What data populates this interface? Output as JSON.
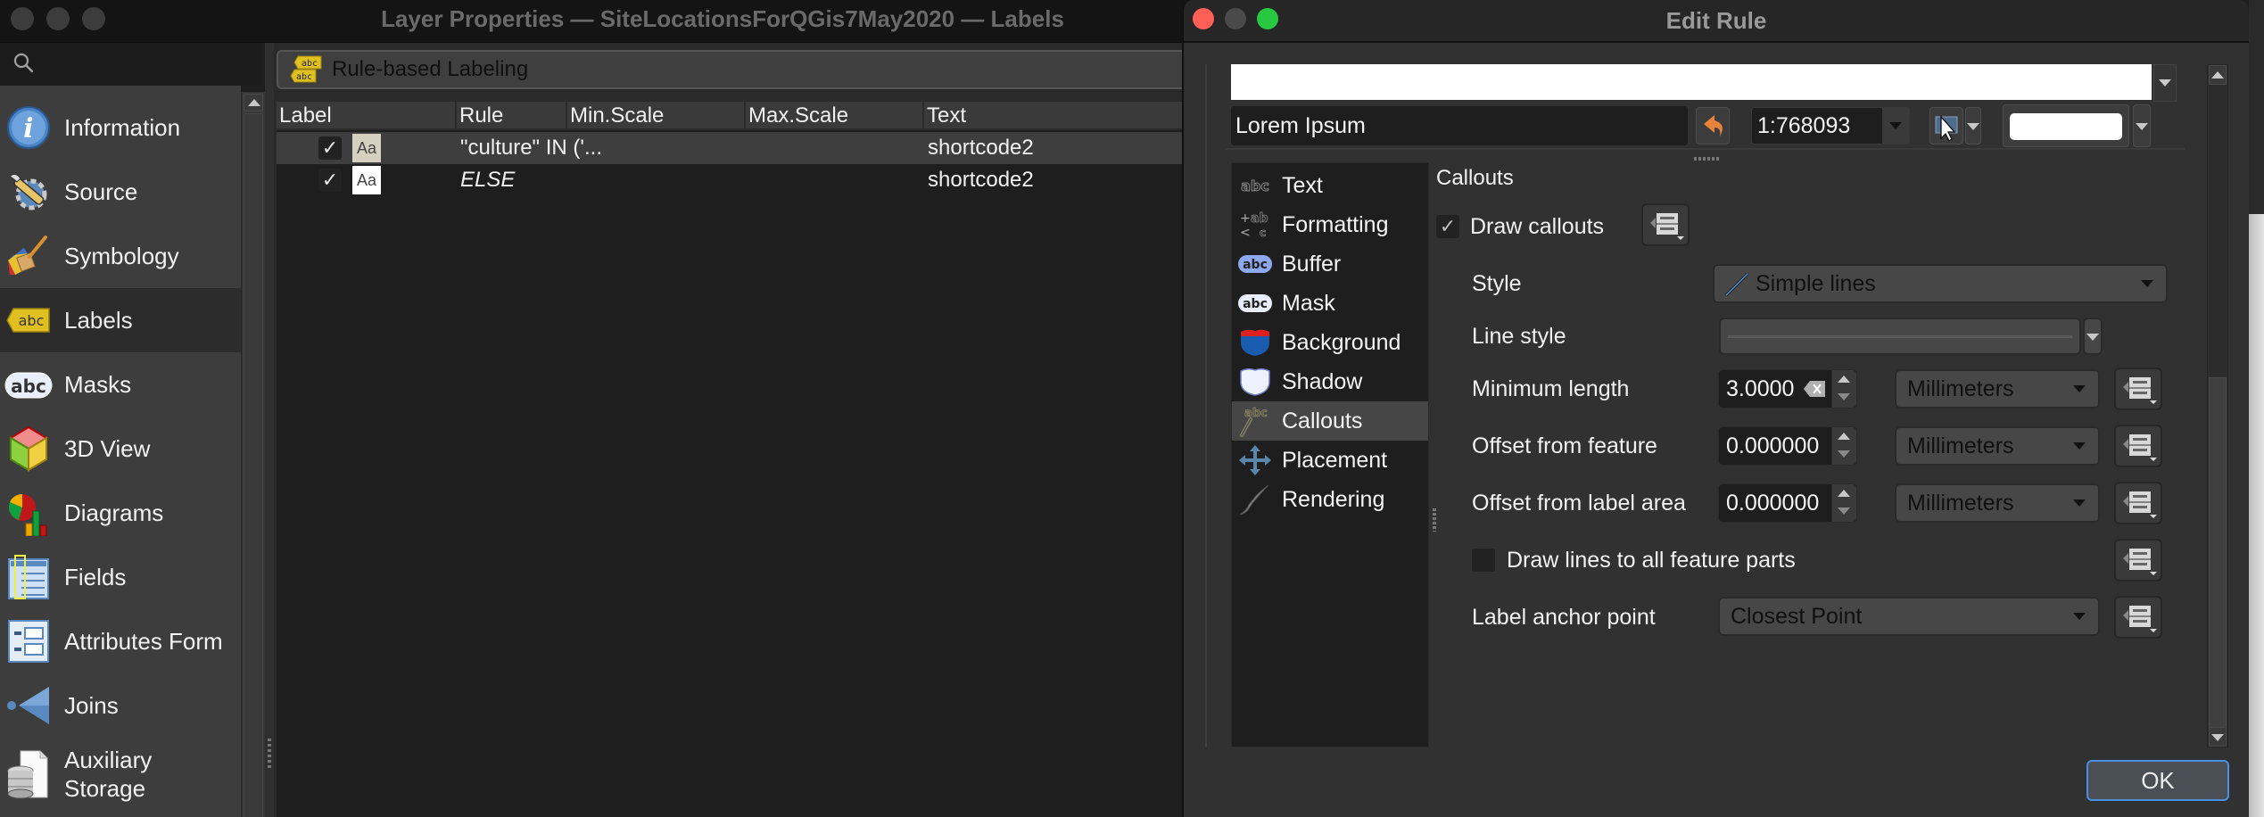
{
  "main_window": {
    "title": "Layer Properties — SiteLocationsForQGis7May2020 — Labels",
    "search": {
      "placeholder": "",
      "value": ""
    },
    "sidebar": {
      "selected": "Labels",
      "items": [
        {
          "label": "Information",
          "icon": "information-icon"
        },
        {
          "label": "Source",
          "icon": "source-icon"
        },
        {
          "label": "Symbology",
          "icon": "symbology-icon"
        },
        {
          "label": "Labels",
          "icon": "labels-icon"
        },
        {
          "label": "Masks",
          "icon": "masks-icon"
        },
        {
          "label": "3D View",
          "icon": "3d-view-icon"
        },
        {
          "label": "Diagrams",
          "icon": "diagrams-icon"
        },
        {
          "label": "Fields",
          "icon": "fields-icon"
        },
        {
          "label": "Attributes Form",
          "icon": "attributes-form-icon"
        },
        {
          "label": "Joins",
          "icon": "joins-icon"
        },
        {
          "label": "Auxiliary Storage",
          "icon": "auxiliary-storage-icon"
        }
      ]
    },
    "labeling_mode": "Rule-based Labeling",
    "rules_table": {
      "columns": [
        "Label",
        "Rule",
        "Min.Scale",
        "Max.Scale",
        "Text"
      ],
      "rows": [
        {
          "checked": true,
          "preview": "Aa",
          "rule": "\"culture\" IN ('...",
          "min_scale": "",
          "max_scale": "",
          "text": "shortcode2",
          "selected": true
        },
        {
          "checked": true,
          "preview": "Aa",
          "rule": "ELSE",
          "min_scale": "",
          "max_scale": "",
          "text": "shortcode2",
          "selected": false
        }
      ]
    }
  },
  "dialog": {
    "title": "Edit Rule",
    "preview": {
      "sample_text": "Lorem Ipsum",
      "scale": "1:768093",
      "background_color": "#ffffff"
    },
    "tabs": [
      {
        "label": "Text",
        "icon": "text-abc-icon"
      },
      {
        "label": "Formatting",
        "icon": "formatting-icon"
      },
      {
        "label": "Buffer",
        "icon": "buffer-icon"
      },
      {
        "label": "Mask",
        "icon": "mask-icon"
      },
      {
        "label": "Background",
        "icon": "background-shield-icon"
      },
      {
        "label": "Shadow",
        "icon": "shadow-shield-icon"
      },
      {
        "label": "Callouts",
        "icon": "callouts-icon"
      },
      {
        "label": "Placement",
        "icon": "placement-arrows-icon"
      },
      {
        "label": "Rendering",
        "icon": "rendering-brush-icon"
      }
    ],
    "selected_tab": "Callouts",
    "callouts": {
      "section_title": "Callouts",
      "draw_callouts": {
        "label": "Draw callouts",
        "checked": true
      },
      "style": {
        "label": "Style",
        "value": "Simple lines"
      },
      "line_style": {
        "label": "Line style"
      },
      "minimum_length": {
        "label": "Minimum length",
        "value": "3.0000",
        "unit": "Millimeters"
      },
      "offset_from_feature": {
        "label": "Offset from feature",
        "value": "0.000000",
        "unit": "Millimeters"
      },
      "offset_from_label_area": {
        "label": "Offset from label area",
        "value": "0.000000",
        "unit": "Millimeters"
      },
      "draw_lines_all_parts": {
        "label": "Draw lines to all feature parts",
        "checked": false
      },
      "label_anchor_point": {
        "label": "Label anchor point",
        "value": "Closest Point"
      }
    },
    "ok_label": "OK"
  },
  "colors": {
    "accent_focus": "#4a90e2",
    "close_red": "#fe5f57",
    "zoom_green": "#28c840",
    "undo_orange": "#e8823a"
  }
}
